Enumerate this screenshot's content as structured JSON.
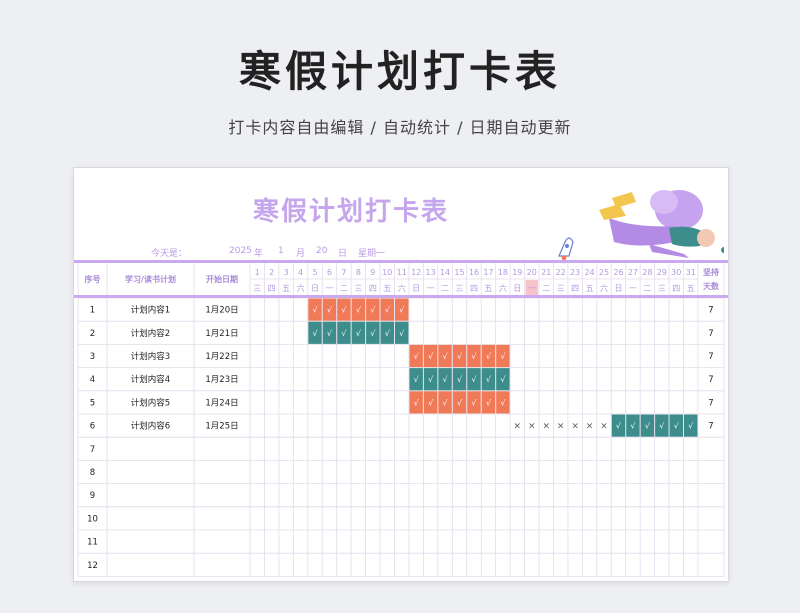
{
  "page": {
    "title": "寒假计划打卡表",
    "subtitle": "打卡内容自由编辑 / 自动统计 / 日期自动更新"
  },
  "sheet": {
    "title": "寒假计划打卡表",
    "today_label": "今天是：",
    "year": "2025",
    "year_unit": "年",
    "month": "1",
    "month_unit": "月",
    "day": "20",
    "day_unit": "日",
    "weekday": "星期一",
    "headers": {
      "index": "序号",
      "plan": "学习/读书计划",
      "start": "开始日期",
      "persist_line1": "坚持",
      "persist_line2": "天数"
    },
    "day_numbers": [
      "1",
      "2",
      "3",
      "4",
      "5",
      "6",
      "7",
      "8",
      "9",
      "10",
      "11",
      "12",
      "13",
      "14",
      "15",
      "16",
      "17",
      "18",
      "19",
      "20",
      "21",
      "22",
      "23",
      "24",
      "25",
      "26",
      "27",
      "28",
      "29",
      "30",
      "31"
    ],
    "weekdays": [
      "三",
      "四",
      "五",
      "六",
      "日",
      "一",
      "二",
      "三",
      "四",
      "五",
      "六",
      "日",
      "一",
      "二",
      "三",
      "四",
      "五",
      "六",
      "日",
      "一",
      "二",
      "三",
      "四",
      "五",
      "六",
      "日",
      "一",
      "二",
      "三",
      "四",
      "五"
    ],
    "today_column": 20,
    "colors": {
      "orange": "#f07a58",
      "teal": "#3d8d8c",
      "accent": "#c9a9ef",
      "today_highlight": "#f6c3c9"
    },
    "rows": [
      {
        "index": "1",
        "plan": "计划内容1",
        "start": "1月20日",
        "days": "7",
        "marks": [
          {
            "start": 5,
            "end": 11,
            "type": "check",
            "color": "orange"
          }
        ]
      },
      {
        "index": "2",
        "plan": "计划内容2",
        "start": "1月21日",
        "days": "7",
        "marks": [
          {
            "start": 5,
            "end": 11,
            "type": "check",
            "color": "teal"
          }
        ]
      },
      {
        "index": "3",
        "plan": "计划内容3",
        "start": "1月22日",
        "days": "7",
        "marks": [
          {
            "start": 12,
            "end": 18,
            "type": "check",
            "color": "orange"
          }
        ]
      },
      {
        "index": "4",
        "plan": "计划内容4",
        "start": "1月23日",
        "days": "7",
        "marks": [
          {
            "start": 12,
            "end": 18,
            "type": "check",
            "color": "teal"
          }
        ]
      },
      {
        "index": "5",
        "plan": "计划内容5",
        "start": "1月24日",
        "days": "7",
        "marks": [
          {
            "start": 12,
            "end": 18,
            "type": "check",
            "color": "orange"
          }
        ]
      },
      {
        "index": "6",
        "plan": "计划内容6",
        "start": "1月25日",
        "days": "7",
        "marks": [
          {
            "start": 19,
            "end": 25,
            "type": "x",
            "color": ""
          },
          {
            "start": 26,
            "end": 32,
            "type": "check",
            "color": "teal"
          }
        ]
      },
      {
        "index": "7",
        "plan": "",
        "start": "",
        "days": "",
        "marks": []
      },
      {
        "index": "8",
        "plan": "",
        "start": "",
        "days": "",
        "marks": []
      },
      {
        "index": "9",
        "plan": "",
        "start": "",
        "days": "",
        "marks": []
      },
      {
        "index": "10",
        "plan": "",
        "start": "",
        "days": "",
        "marks": []
      },
      {
        "index": "11",
        "plan": "",
        "start": "",
        "days": "",
        "marks": []
      },
      {
        "index": "12",
        "plan": "",
        "start": "",
        "days": "",
        "marks": []
      }
    ],
    "check_symbol": "√",
    "x_symbol": "×"
  }
}
